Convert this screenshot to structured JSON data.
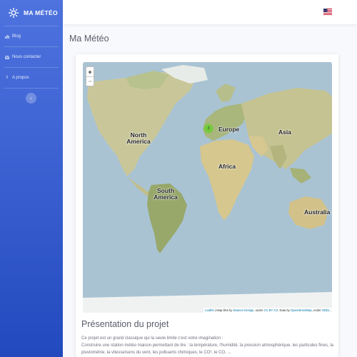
{
  "brand": {
    "name": "MA MÉTÉO",
    "icon": "sun-icon"
  },
  "sidebar": {
    "items": [
      {
        "label": "Blog",
        "icon": "chart-icon"
      },
      {
        "label": "Nous contacter",
        "icon": "envelope-icon"
      },
      {
        "label": "A propos",
        "icon": "info-icon"
      }
    ],
    "toggle_glyph": "‹"
  },
  "topbar": {
    "language_flag": "us-flag-icon"
  },
  "page": {
    "title": "Ma Météo"
  },
  "map": {
    "zoom_in": "+",
    "zoom_out": "−",
    "cluster_count": "3",
    "labels": {
      "north_america": "North America",
      "south_america": "South America",
      "europe": "Europe",
      "asia": "Asia",
      "africa": "Africa",
      "australia": "Australia"
    },
    "attribution": {
      "leaflet": "Leaflet",
      "text1": " | Map tiles by ",
      "stamen": "Stamen Design",
      "text2": ", under ",
      "ccby": "CC BY 3.0",
      "text3": ". Data by ",
      "osm": "OpenStreetMap",
      "text4": ", under ",
      "odbl": "ODbL",
      "text5": "."
    }
  },
  "presentation": {
    "title": "Présentation du projet",
    "line1": "Ce projet est un grand classique qui la seule limite c'est votre imagination :",
    "line2": "Construire une station météo maison permettant de lire : la température, l'humidité, la pression atmosphérique, les particules fines, la pluviométrie, la vitesse/sens du vent, les polluants chimiques, le CO², le CO, ..."
  },
  "colors": {
    "sidebar_top": "#4e73df",
    "sidebar_bottom": "#224abe",
    "ocean": "#a9c3d3",
    "land": "#c9c79a",
    "cluster": "#6ecc39"
  }
}
